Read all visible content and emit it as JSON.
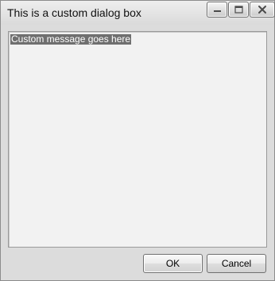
{
  "window": {
    "title": "This is a custom dialog box",
    "controls": {
      "minimize_icon": "minimize-icon",
      "maximize_icon": "maximize-icon",
      "close_icon": "close-icon"
    }
  },
  "message": {
    "text": "Custom message goes here"
  },
  "buttons": {
    "ok_label": "OK",
    "cancel_label": "Cancel"
  },
  "colors": {
    "window_bg": "#dcdcdc",
    "message_area_bg": "#f2f2f2",
    "selection_bg": "#6f6f6f"
  }
}
